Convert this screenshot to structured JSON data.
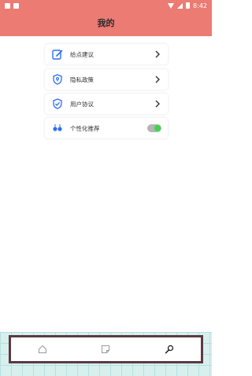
{
  "status_bar": {
    "time": "8:42"
  },
  "header": {
    "title": "我的"
  },
  "menu": {
    "items": [
      {
        "label": "给点建议",
        "icon": "edit-icon",
        "accessory": "chevron"
      },
      {
        "label": "隐私政策",
        "icon": "shield-icon",
        "accessory": "chevron"
      },
      {
        "label": "用户协议",
        "icon": "shield-check-icon",
        "accessory": "chevron"
      },
      {
        "label": "个性化推荐",
        "icon": "toggle-setting-icon",
        "accessory": "toggle",
        "enabled": true
      }
    ]
  },
  "tabbar": {
    "items": [
      {
        "icon": "home-icon"
      },
      {
        "icon": "note-icon"
      },
      {
        "icon": "search-icon",
        "active": true
      }
    ]
  },
  "colors": {
    "header_bg": "#ec7b73",
    "accent_blue": "#2d6df6",
    "toggle_on": "#3cd64b",
    "tabbar_border": "#5b3a40"
  }
}
